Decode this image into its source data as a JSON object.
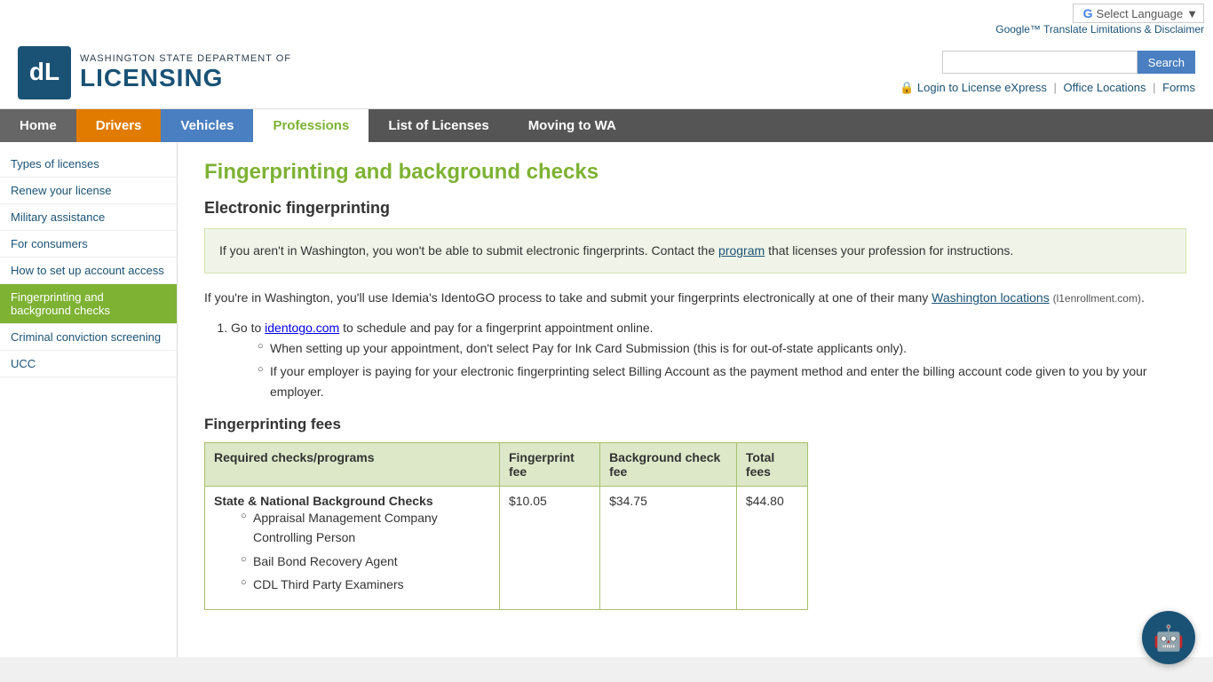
{
  "topbar": {
    "translate_text": "Google™ Translate Limitations & Disclaimer",
    "select_language": "Select Language"
  },
  "header": {
    "dept_line1": "WASHINGTON STATE DEPARTMENT OF",
    "dept_line2": "LICENSING",
    "search_placeholder": "",
    "search_btn": "Search",
    "login_link": "Login to License eXpress",
    "office_link": "Office Locations",
    "forms_link": "Forms"
  },
  "nav": {
    "items": [
      {
        "label": "Home",
        "class": "nav-home"
      },
      {
        "label": "Drivers",
        "class": "nav-drivers"
      },
      {
        "label": "Vehicles",
        "class": "nav-vehicles"
      },
      {
        "label": "Professions",
        "class": "nav-professions"
      },
      {
        "label": "List of Licenses",
        "class": "nav-list"
      },
      {
        "label": "Moving to WA",
        "class": "nav-moving"
      }
    ]
  },
  "sidebar": {
    "items": [
      {
        "label": "Types of licenses",
        "active": false
      },
      {
        "label": "Renew your license",
        "active": false
      },
      {
        "label": "Military assistance",
        "active": false
      },
      {
        "label": "For consumers",
        "active": false
      },
      {
        "label": "How to set up account access",
        "active": false
      },
      {
        "label": "Fingerprinting and background checks",
        "active": true
      },
      {
        "label": "Criminal conviction screening",
        "active": false
      },
      {
        "label": "UCC",
        "active": false
      }
    ]
  },
  "content": {
    "page_title": "Fingerprinting and background checks",
    "electronic_section": "Electronic fingerprinting",
    "info_box_text": "If you aren't in Washington, you won't be able to submit electronic fingerprints. Contact the",
    "info_box_link": "program",
    "info_box_suffix": "that licenses your profession for instructions.",
    "para1_prefix": "If you're in Washington, you'll use Idemia's IdentoGO process to take and submit your fingerprints electronically at one of their many",
    "para1_link": "Washington locations",
    "para1_link_note": "(l1enrollment.com)",
    "list_item1_prefix": "Go to",
    "list_item1_link": "identogo.com",
    "list_item1_suffix": "to schedule and pay for a fingerprint appointment online.",
    "bullet1": "When setting up your appointment, don't select Pay for Ink Card Submission (this is for out-of-state applicants only).",
    "bullet2": "If your employer is paying for your electronic fingerprinting select Billing Account as the payment method and enter the billing account code given to you by your employer.",
    "fees_title": "Fingerprinting fees",
    "table": {
      "headers": [
        "Required checks/programs",
        "Fingerprint fee",
        "Background check fee",
        "Total fees"
      ],
      "rows": [
        {
          "program": "State & National Background Checks",
          "bullets": [
            "Appraisal Management Company Controlling Person",
            "Bail Bond Recovery Agent",
            "CDL Third Party Examiners"
          ],
          "fingerprint_fee": "$10.05",
          "background_fee": "$34.75",
          "total_fee": "$44.80"
        }
      ]
    }
  }
}
